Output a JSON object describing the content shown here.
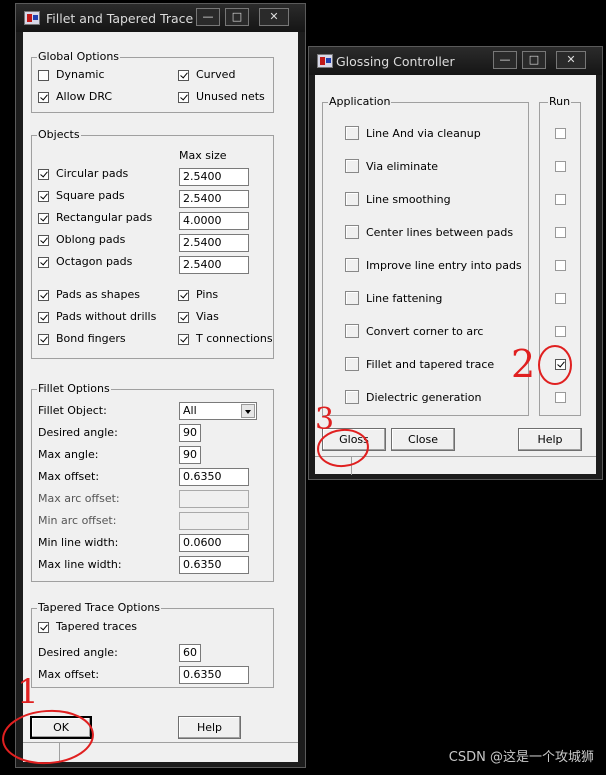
{
  "fillet_window": {
    "title": "Fillet and Tapered Trace",
    "global_options": {
      "label": "Global Options",
      "items": [
        {
          "label": "Dynamic",
          "checked": false
        },
        {
          "label": "Curved",
          "checked": true
        },
        {
          "label": "Allow DRC",
          "checked": true
        },
        {
          "label": "Unused nets",
          "checked": true
        }
      ]
    },
    "objects": {
      "label": "Objects",
      "max_size_header": "Max size",
      "pads": [
        {
          "label": "Circular pads",
          "checked": true,
          "value": "2.5400"
        },
        {
          "label": "Square pads",
          "checked": true,
          "value": "2.5400"
        },
        {
          "label": "Rectangular pads",
          "checked": true,
          "value": "4.0000"
        },
        {
          "label": "Oblong pads",
          "checked": true,
          "value": "2.5400"
        },
        {
          "label": "Octagon pads",
          "checked": true,
          "value": "2.5400"
        }
      ],
      "other": [
        {
          "label": "Pads as shapes",
          "checked": true
        },
        {
          "label": "Pins",
          "checked": true
        },
        {
          "label": "Pads without drills",
          "checked": true
        },
        {
          "label": "Vias",
          "checked": true
        },
        {
          "label": "Bond fingers",
          "checked": true
        },
        {
          "label": "T connections",
          "checked": true
        }
      ]
    },
    "fillet_options": {
      "label": "Fillet Options",
      "fillet_object_label": "Fillet Object:",
      "fillet_object_value": "All",
      "rows": [
        {
          "label": "Desired angle:",
          "value": "90"
        },
        {
          "label": "Max angle:",
          "value": "90"
        },
        {
          "label": "Max offset:",
          "value": "0.6350"
        },
        {
          "label": "Max arc offset:",
          "value": ""
        },
        {
          "label": "Min arc offset:",
          "value": ""
        },
        {
          "label": "Min line width:",
          "value": "0.0600"
        },
        {
          "label": "Max line width:",
          "value": "0.6350"
        }
      ]
    },
    "tapered_options": {
      "label": "Tapered Trace Options",
      "tapered_label": "Tapered traces",
      "tapered_checked": true,
      "desired_angle_label": "Desired angle:",
      "desired_angle_value": "60",
      "max_offset_label": "Max offset:",
      "max_offset_value": "0.6350"
    },
    "ok_label": "OK",
    "help_label": "Help"
  },
  "gloss_window": {
    "title": "Glossing Controller",
    "application_label": "Application",
    "run_label": "Run",
    "items": [
      {
        "label": "Line And via cleanup",
        "run": false
      },
      {
        "label": "Via eliminate",
        "run": false
      },
      {
        "label": "Line smoothing",
        "run": false
      },
      {
        "label": "Center lines between pads",
        "run": false
      },
      {
        "label": "Improve line entry into pads",
        "run": false
      },
      {
        "label": "Line fattening",
        "run": false
      },
      {
        "label": "Convert corner to arc",
        "run": false
      },
      {
        "label": "Fillet and tapered trace",
        "run": true
      },
      {
        "label": "Dielectric generation",
        "run": false
      }
    ],
    "gloss_label": "Gloss",
    "close_label": "Close",
    "help_label": "Help"
  },
  "annotations": {
    "one": "1",
    "two": "2",
    "three": "3"
  },
  "watermark": "CSDN @这是一个攻城狮",
  "colors": {
    "annotation": "#e02020",
    "title_bar": "#1c1c1c",
    "dialog_bg": "#f0f0f0"
  }
}
